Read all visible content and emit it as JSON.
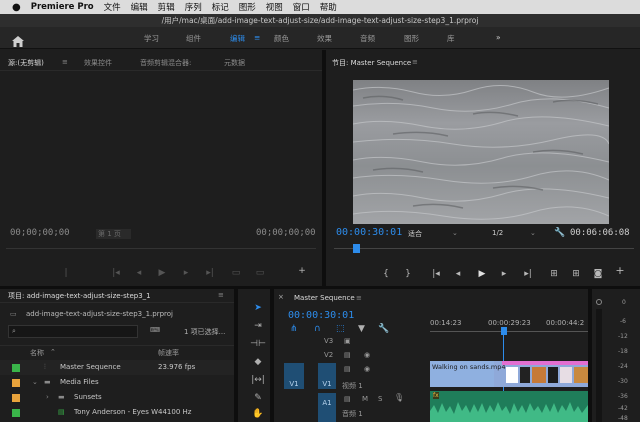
{
  "menubar": {
    "apple_icon": "apple-icon",
    "app": "Premiere Pro",
    "items": [
      "文件",
      "编辑",
      "剪辑",
      "序列",
      "标记",
      "图形",
      "视图",
      "窗口",
      "帮助"
    ]
  },
  "title": "/用户/mac/桌面/add-image-text-adjust-size/add-image-text-adjust-size-step3_1.prproj",
  "workspaces": {
    "home_icon": "home-icon",
    "tabs": [
      "学习",
      "组件",
      "编辑",
      "颜色",
      "效果",
      "音频",
      "图形",
      "库"
    ],
    "active": "编辑",
    "menu_glyph": "≡",
    "more": "»"
  },
  "source": {
    "tabs": [
      "源:(无剪辑)",
      "效果控件",
      "音频剪辑混合器:",
      "元数据"
    ],
    "menu_glyph": "≡",
    "tc_left": "00;00;00;00",
    "page": "第 1 页",
    "tc_right": "00;00;00;00"
  },
  "program": {
    "title": "节目: Master Sequence",
    "menu_glyph": "≡",
    "tc": "00:00:30:01",
    "fit": "适合",
    "res": "1/2",
    "duration": "00:06:06:08"
  },
  "project": {
    "title": "项目: add-image-text-adjust-size-step3_1",
    "menu_glyph": "≡",
    "file": "add-image-text-adjust-size-step3_1.prproj",
    "selection": "1 项已选择...",
    "columns": [
      "名称",
      "帧速率"
    ],
    "rows": [
      {
        "name": "Master Sequence",
        "rate": "23.976 fps",
        "color": "#3ab54a"
      },
      {
        "name": "Media Files",
        "rate": "",
        "color": "#e8a33c"
      },
      {
        "name": "Sunsets",
        "rate": "",
        "color": "#e8a33c"
      },
      {
        "name": "Tony Anderson - Eyes W",
        "rate": "44100 Hz",
        "color": "#3ab54a"
      }
    ]
  },
  "timeline": {
    "close": "×",
    "title": "Master Sequence",
    "menu_glyph": "≡",
    "tc": "00:00:30:01",
    "ruler": [
      "00:14:23",
      "00:00:29:23",
      "00:00:44:2"
    ],
    "tracks": {
      "v3": "V3",
      "v2": "V2",
      "v1": "V1",
      "v1b": "V1",
      "a1": "A1",
      "v1name": "视频 1",
      "a1name": "音频 1",
      "m": "M",
      "s": "S",
      "fx": "fx"
    },
    "clip": "Walking on sands.mp4"
  },
  "meter": {
    "labels": [
      "0",
      "-6",
      "-12",
      "-18",
      "-24",
      "-30",
      "-36",
      "-42",
      "-48"
    ]
  }
}
